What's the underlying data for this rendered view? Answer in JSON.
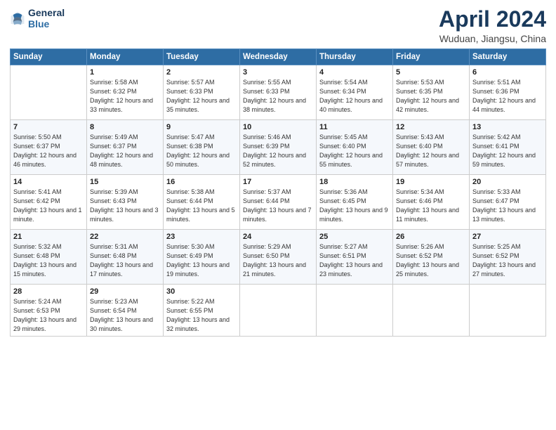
{
  "header": {
    "logo_line1": "General",
    "logo_line2": "Blue",
    "title": "April 2024",
    "subtitle": "Wuduan, Jiangsu, China"
  },
  "weekdays": [
    "Sunday",
    "Monday",
    "Tuesday",
    "Wednesday",
    "Thursday",
    "Friday",
    "Saturday"
  ],
  "weeks": [
    [
      {
        "day": "",
        "sunrise": "",
        "sunset": "",
        "daylight": ""
      },
      {
        "day": "1",
        "sunrise": "Sunrise: 5:58 AM",
        "sunset": "Sunset: 6:32 PM",
        "daylight": "Daylight: 12 hours and 33 minutes."
      },
      {
        "day": "2",
        "sunrise": "Sunrise: 5:57 AM",
        "sunset": "Sunset: 6:33 PM",
        "daylight": "Daylight: 12 hours and 35 minutes."
      },
      {
        "day": "3",
        "sunrise": "Sunrise: 5:55 AM",
        "sunset": "Sunset: 6:33 PM",
        "daylight": "Daylight: 12 hours and 38 minutes."
      },
      {
        "day": "4",
        "sunrise": "Sunrise: 5:54 AM",
        "sunset": "Sunset: 6:34 PM",
        "daylight": "Daylight: 12 hours and 40 minutes."
      },
      {
        "day": "5",
        "sunrise": "Sunrise: 5:53 AM",
        "sunset": "Sunset: 6:35 PM",
        "daylight": "Daylight: 12 hours and 42 minutes."
      },
      {
        "day": "6",
        "sunrise": "Sunrise: 5:51 AM",
        "sunset": "Sunset: 6:36 PM",
        "daylight": "Daylight: 12 hours and 44 minutes."
      }
    ],
    [
      {
        "day": "7",
        "sunrise": "Sunrise: 5:50 AM",
        "sunset": "Sunset: 6:37 PM",
        "daylight": "Daylight: 12 hours and 46 minutes."
      },
      {
        "day": "8",
        "sunrise": "Sunrise: 5:49 AM",
        "sunset": "Sunset: 6:37 PM",
        "daylight": "Daylight: 12 hours and 48 minutes."
      },
      {
        "day": "9",
        "sunrise": "Sunrise: 5:47 AM",
        "sunset": "Sunset: 6:38 PM",
        "daylight": "Daylight: 12 hours and 50 minutes."
      },
      {
        "day": "10",
        "sunrise": "Sunrise: 5:46 AM",
        "sunset": "Sunset: 6:39 PM",
        "daylight": "Daylight: 12 hours and 52 minutes."
      },
      {
        "day": "11",
        "sunrise": "Sunrise: 5:45 AM",
        "sunset": "Sunset: 6:40 PM",
        "daylight": "Daylight: 12 hours and 55 minutes."
      },
      {
        "day": "12",
        "sunrise": "Sunrise: 5:43 AM",
        "sunset": "Sunset: 6:40 PM",
        "daylight": "Daylight: 12 hours and 57 minutes."
      },
      {
        "day": "13",
        "sunrise": "Sunrise: 5:42 AM",
        "sunset": "Sunset: 6:41 PM",
        "daylight": "Daylight: 12 hours and 59 minutes."
      }
    ],
    [
      {
        "day": "14",
        "sunrise": "Sunrise: 5:41 AM",
        "sunset": "Sunset: 6:42 PM",
        "daylight": "Daylight: 13 hours and 1 minute."
      },
      {
        "day": "15",
        "sunrise": "Sunrise: 5:39 AM",
        "sunset": "Sunset: 6:43 PM",
        "daylight": "Daylight: 13 hours and 3 minutes."
      },
      {
        "day": "16",
        "sunrise": "Sunrise: 5:38 AM",
        "sunset": "Sunset: 6:44 PM",
        "daylight": "Daylight: 13 hours and 5 minutes."
      },
      {
        "day": "17",
        "sunrise": "Sunrise: 5:37 AM",
        "sunset": "Sunset: 6:44 PM",
        "daylight": "Daylight: 13 hours and 7 minutes."
      },
      {
        "day": "18",
        "sunrise": "Sunrise: 5:36 AM",
        "sunset": "Sunset: 6:45 PM",
        "daylight": "Daylight: 13 hours and 9 minutes."
      },
      {
        "day": "19",
        "sunrise": "Sunrise: 5:34 AM",
        "sunset": "Sunset: 6:46 PM",
        "daylight": "Daylight: 13 hours and 11 minutes."
      },
      {
        "day": "20",
        "sunrise": "Sunrise: 5:33 AM",
        "sunset": "Sunset: 6:47 PM",
        "daylight": "Daylight: 13 hours and 13 minutes."
      }
    ],
    [
      {
        "day": "21",
        "sunrise": "Sunrise: 5:32 AM",
        "sunset": "Sunset: 6:48 PM",
        "daylight": "Daylight: 13 hours and 15 minutes."
      },
      {
        "day": "22",
        "sunrise": "Sunrise: 5:31 AM",
        "sunset": "Sunset: 6:48 PM",
        "daylight": "Daylight: 13 hours and 17 minutes."
      },
      {
        "day": "23",
        "sunrise": "Sunrise: 5:30 AM",
        "sunset": "Sunset: 6:49 PM",
        "daylight": "Daylight: 13 hours and 19 minutes."
      },
      {
        "day": "24",
        "sunrise": "Sunrise: 5:29 AM",
        "sunset": "Sunset: 6:50 PM",
        "daylight": "Daylight: 13 hours and 21 minutes."
      },
      {
        "day": "25",
        "sunrise": "Sunrise: 5:27 AM",
        "sunset": "Sunset: 6:51 PM",
        "daylight": "Daylight: 13 hours and 23 minutes."
      },
      {
        "day": "26",
        "sunrise": "Sunrise: 5:26 AM",
        "sunset": "Sunset: 6:52 PM",
        "daylight": "Daylight: 13 hours and 25 minutes."
      },
      {
        "day": "27",
        "sunrise": "Sunrise: 5:25 AM",
        "sunset": "Sunset: 6:52 PM",
        "daylight": "Daylight: 13 hours and 27 minutes."
      }
    ],
    [
      {
        "day": "28",
        "sunrise": "Sunrise: 5:24 AM",
        "sunset": "Sunset: 6:53 PM",
        "daylight": "Daylight: 13 hours and 29 minutes."
      },
      {
        "day": "29",
        "sunrise": "Sunrise: 5:23 AM",
        "sunset": "Sunset: 6:54 PM",
        "daylight": "Daylight: 13 hours and 30 minutes."
      },
      {
        "day": "30",
        "sunrise": "Sunrise: 5:22 AM",
        "sunset": "Sunset: 6:55 PM",
        "daylight": "Daylight: 13 hours and 32 minutes."
      },
      {
        "day": "",
        "sunrise": "",
        "sunset": "",
        "daylight": ""
      },
      {
        "day": "",
        "sunrise": "",
        "sunset": "",
        "daylight": ""
      },
      {
        "day": "",
        "sunrise": "",
        "sunset": "",
        "daylight": ""
      },
      {
        "day": "",
        "sunrise": "",
        "sunset": "",
        "daylight": ""
      }
    ]
  ]
}
